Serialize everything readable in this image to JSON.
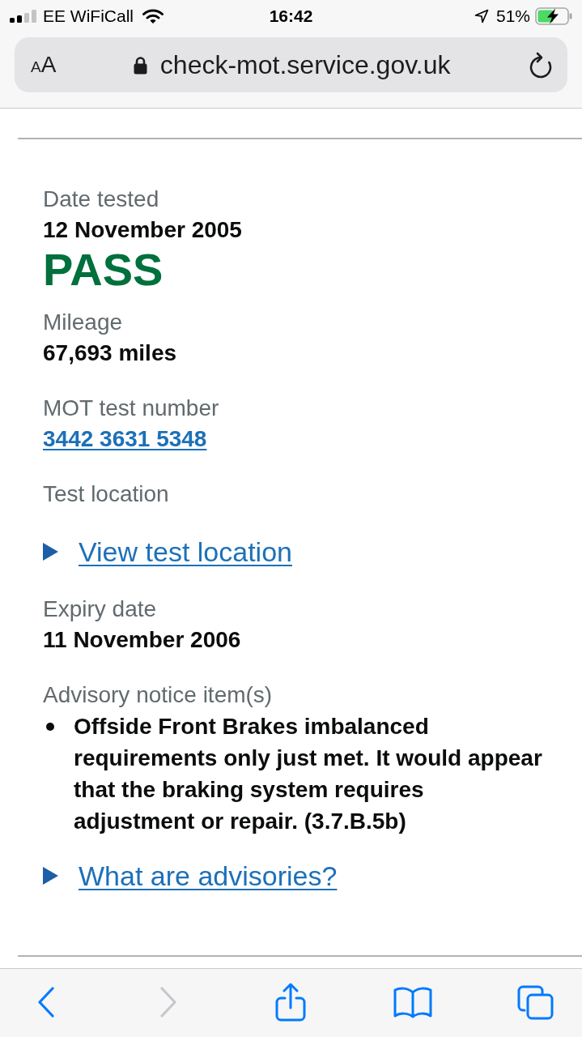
{
  "status_bar": {
    "carrier": "EE WiFiCall",
    "time": "16:42",
    "battery": "51%"
  },
  "address_bar": {
    "text_size_button": {
      "small_letter": "A",
      "large_letter": "A"
    },
    "url": "check-mot.service.gov.uk"
  },
  "record": [
    {
      "kind": "field",
      "label": "Date tested",
      "value": "12 November 2005"
    },
    {
      "kind": "result",
      "passed": true,
      "text": "PASS"
    },
    {
      "kind": "field",
      "label": "Mileage",
      "value": "67,693 miles"
    },
    {
      "kind": "link_field",
      "label": "MOT test number",
      "value": "3442 3631 5348"
    },
    {
      "kind": "details_field",
      "label": "Test location",
      "summary": "View test location",
      "expanded": false
    },
    {
      "kind": "field",
      "label": "Expiry date",
      "value": "11 November 2006"
    },
    {
      "kind": "list_field",
      "label": "Advisory notice item(s)",
      "items": [
        "Offside Front Brakes imbalanced requirements only just met. It would appear that the braking system requires adjustment or repair. (3.7.B.5b)"
      ]
    },
    {
      "kind": "details",
      "summary": "What are advisories?",
      "expanded": false
    }
  ],
  "toolbar": [
    {
      "kind": "back",
      "disabled": false
    },
    {
      "kind": "forward",
      "disabled": true
    },
    {
      "kind": "share",
      "disabled": false
    },
    {
      "kind": "bookmarks",
      "disabled": false
    },
    {
      "kind": "tabs",
      "disabled": false
    }
  ]
}
